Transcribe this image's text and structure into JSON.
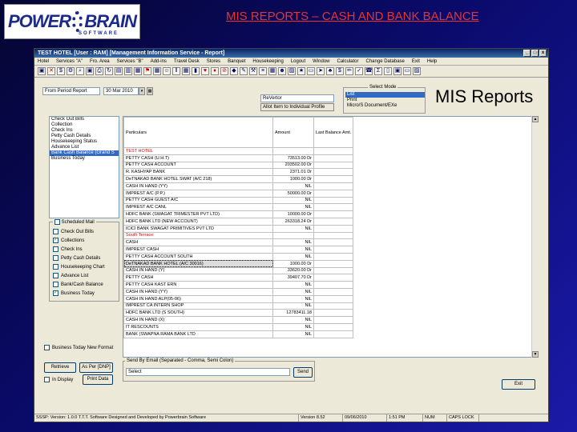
{
  "slide": {
    "logo": "POWER BRAIN",
    "logo_sub": "SOFTWARE",
    "title": "MIS REPORTS – CASH AND BANK BALANCE"
  },
  "window": {
    "title": "TEST HOTEL [User : RAM]   [Management Information Service - Report]",
    "controls": [
      "_",
      "□",
      "x"
    ],
    "menu": [
      "Hotel",
      "Services \"A\"",
      "Fro. Area",
      "Services \"B\"",
      "Add-ins",
      "Travel Desk",
      "Stores",
      "Banquet",
      "Housekeeping",
      "Logout",
      "Window",
      "Calculator",
      "Change Database",
      "Exit",
      "Help"
    ],
    "toolbar_icons": [
      "save-icon",
      "close-icon",
      "cash-icon",
      "settings-icon",
      "search-icon",
      "save-icon",
      "print-icon",
      "refresh-icon",
      "book-icon",
      "building-icon",
      "chart-icon",
      "flag-icon",
      "grid-icon",
      "person-icon",
      "columns-icon",
      "grid-icon",
      "bar-icon",
      "heart-icon",
      "drop-icon",
      "ban-icon",
      "diamond-icon",
      "pen-icon",
      "tools-icon",
      "layers-icon",
      "chart-icon",
      "people-icon",
      "image-icon",
      "star-icon",
      "window-icon",
      "arrow-icon",
      "tree-icon",
      "dollar-icon",
      "pencil-icon",
      "check-icon",
      "phone-icon",
      "sigma-icon",
      "doc-icon",
      "app-icon",
      "monitor-icon",
      "image-icon"
    ]
  },
  "form": {
    "report_type": "From Period Report",
    "date": "30 Mar 2010",
    "list_label": "Allot Item to Individual Profile",
    "mis_title": "MIS Reports",
    "select_mode_label": "Select Mode",
    "modes": [
      "List",
      "Print",
      "Micro/S Document/EXe"
    ],
    "report_list": [
      "Check Out Bills",
      "Collection",
      "Check Ins",
      "Petty Cash Details",
      "Housekeeping Status",
      "Advance List",
      "Bank Cash Balance (Grand S",
      "Business Today"
    ],
    "report_list_selected": 6,
    "scheduled_label": "Scheduled Mail",
    "scheduled_items": [
      {
        "label": "Check Out Bills",
        "checked": false
      },
      {
        "label": "Collections",
        "checked": true
      },
      {
        "label": "Check Ins",
        "checked": false
      },
      {
        "label": "Petty Cash Details",
        "checked": false
      },
      {
        "label": "Housekeeping Chart",
        "checked": false
      },
      {
        "label": "Advance List",
        "checked": false
      },
      {
        "label": "Bank/Cash Balance",
        "checked": false
      },
      {
        "label": "Business Today",
        "checked": true
      }
    ],
    "business_today_label": "Business Today New Format",
    "send_sms_label": "Send By Email (Separated - Comma, Semi Colon)",
    "send_sms_value": "Select",
    "send_button": "Send",
    "retrieve_button": "Retrieve",
    "display_label": "In Display",
    "print_button": "Print Data",
    "exit_button": "Exit",
    "view_button": "As Per [DNP]",
    "grid_headers": {
      "particulars": "Particulars",
      "amount": "Amount",
      "last_balance": "Last Balance Amt."
    },
    "rows": [
      {
        "name": "TEST HOTEL",
        "amount": "",
        "cls": "red"
      },
      {
        "name": "PETTY CASH (U.H.T)",
        "amount": "73513.00 Dr"
      },
      {
        "name": "PETTY CASH ACCOUNT",
        "amount": "203502.00 Dr"
      },
      {
        "name": "R. KASHYAP BANK",
        "amount": "2371.01 Dr"
      },
      {
        "name": "DeTNAKAD BANK HOTEL SWAT (A/C 218)",
        "amount": "1000.00 Dr"
      },
      {
        "name": "CASH IN HAND (YY)",
        "amount": "NIL"
      },
      {
        "name": "IMPREST A/C (P.P.)",
        "amount": "50000.00 Dr"
      },
      {
        "name": "PETTY CASH GUEST A/C",
        "amount": "NIL"
      },
      {
        "name": "IMPREST A/C CANL",
        "amount": "NIL"
      },
      {
        "name": "HDFC BANK (SWAGAT TRIMESTER PVT LTD)",
        "amount": "10000.00 Dr"
      },
      {
        "name": "HDFC BANK LTD (NEW ACCOUNT)",
        "amount": "263318.24 Dr"
      },
      {
        "name": "ICICI BANK SWAGAT PRIMITIVES PVT LTD",
        "amount": "NIL"
      },
      {
        "name": "South Terrace:",
        "amount": "",
        "cls": "red"
      },
      {
        "name": "CASH",
        "amount": "NIL"
      },
      {
        "name": "IMPREST CASH",
        "amount": "NIL"
      },
      {
        "name": "PETTY CASH ACCOUNT SOUTH",
        "amount": "NIL"
      },
      {
        "name": "DeTNAKAD BANK HOTEL (A/C 30016)",
        "amount": "1000.00 Dr",
        "cls": "dotted"
      },
      {
        "name": "CASH IN HAND (Y)",
        "amount": "33620.00 Dr"
      },
      {
        "name": "PETTY CASH",
        "amount": "39407.70 Dr"
      },
      {
        "name": "PETTY CASH KAST ERN",
        "amount": "NIL"
      },
      {
        "name": "CASH IN HAND (YY)",
        "amount": "NIL"
      },
      {
        "name": "CASH IN HAND ALP(05-06)",
        "amount": "NIL"
      },
      {
        "name": "IMPREST CA INTERN SHOP",
        "amount": "NIL"
      },
      {
        "name": "HDFC BANK LTD (S SOUTH)",
        "amount": "12783411.18"
      },
      {
        "name": "CASH IN HAND (X)",
        "amount": "NIL"
      },
      {
        "name": "IT RESCOUNTS",
        "amount": "NIL"
      },
      {
        "name": "BANK (SWAPNA RAMA BANK LTD",
        "amount": "NIL"
      }
    ],
    "right_field": "ReVertor"
  },
  "status_bar": [
    "SSSP: Version: 1.0.0 T.T.T. Software Designed and Developed by Powerbrain Software",
    "Version 8.52",
    "09/06/2010",
    "1:51 PM",
    "NUM",
    "CAPS LOCK"
  ]
}
